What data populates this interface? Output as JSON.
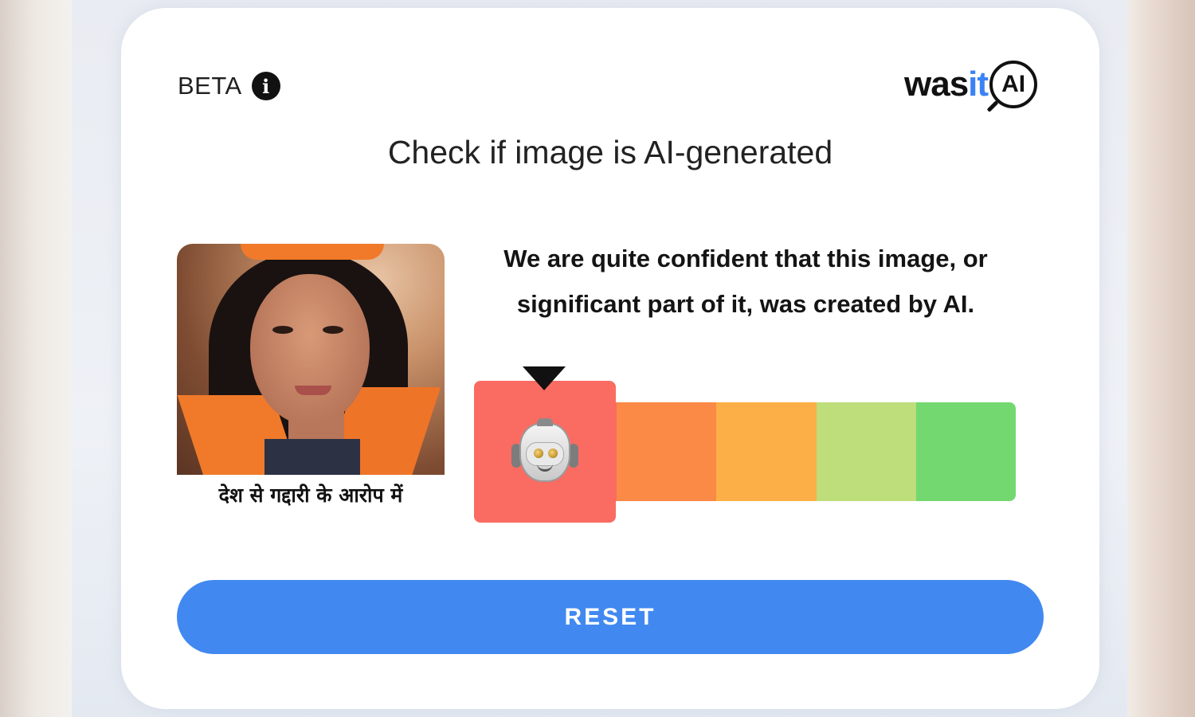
{
  "header": {
    "beta_label": "BETA",
    "info_glyph": "i",
    "logo": {
      "part1": "was",
      "part2": "it",
      "part3": "AI"
    }
  },
  "title": "Check if image is AI-generated",
  "image": {
    "caption": "देश से गद्दारी के आरोप में"
  },
  "result": {
    "message": "We are quite confident that this image, or significant part of it, was created by AI.",
    "meter": {
      "segments": [
        "#fa6b62",
        "#fb8a46",
        "#fcaf47",
        "#bedd7b",
        "#74d871"
      ],
      "selected_index": 0,
      "selected_icon": "robot-icon"
    }
  },
  "actions": {
    "reset_label": "RESET"
  },
  "colors": {
    "accent": "#4189f1",
    "text": "#141414"
  }
}
